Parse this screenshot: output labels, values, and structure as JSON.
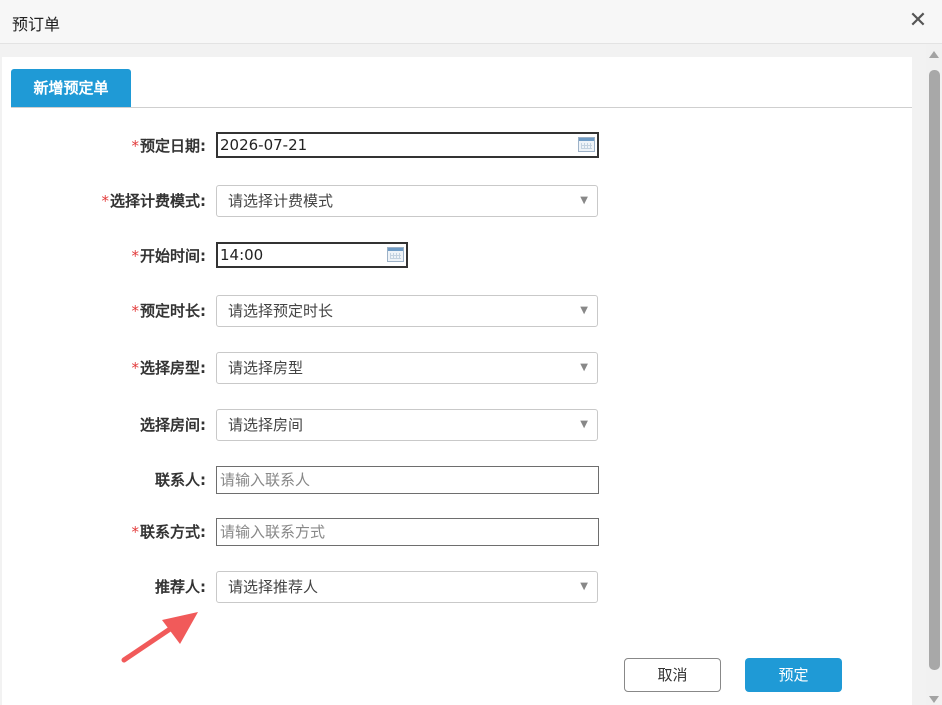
{
  "window": {
    "title": "预订单",
    "close_glyph": "✕"
  },
  "tab": {
    "label": "新增预定单"
  },
  "form": {
    "booking_date": {
      "label": "预定日期:",
      "required": "*",
      "value": "2026-07-21"
    },
    "billing_mode": {
      "label": "选择计费模式:",
      "required": "*",
      "value": "请选择计费模式"
    },
    "start_time": {
      "label": "开始时间:",
      "required": "*",
      "value": "14:00"
    },
    "duration": {
      "label": "预定时长:",
      "required": "*",
      "value": "请选择预定时长"
    },
    "room_type": {
      "label": "选择房型:",
      "required": "*",
      "value": "请选择房型"
    },
    "room": {
      "label": "选择房间:",
      "value": "请选择房间"
    },
    "contact_person": {
      "label": "联系人:",
      "placeholder": "请输入联系人"
    },
    "contact_method": {
      "label": "联系方式:",
      "required": "*",
      "placeholder": "请输入联系方式"
    },
    "referrer": {
      "label": "推荐人:",
      "value": "请选择推荐人"
    }
  },
  "buttons": {
    "cancel": "取消",
    "submit": "预定"
  },
  "icons": {
    "caret": "▼"
  },
  "colors": {
    "accent": "#1f9ad6",
    "required": "#e23b3b",
    "arrow": "#f15a5a"
  }
}
